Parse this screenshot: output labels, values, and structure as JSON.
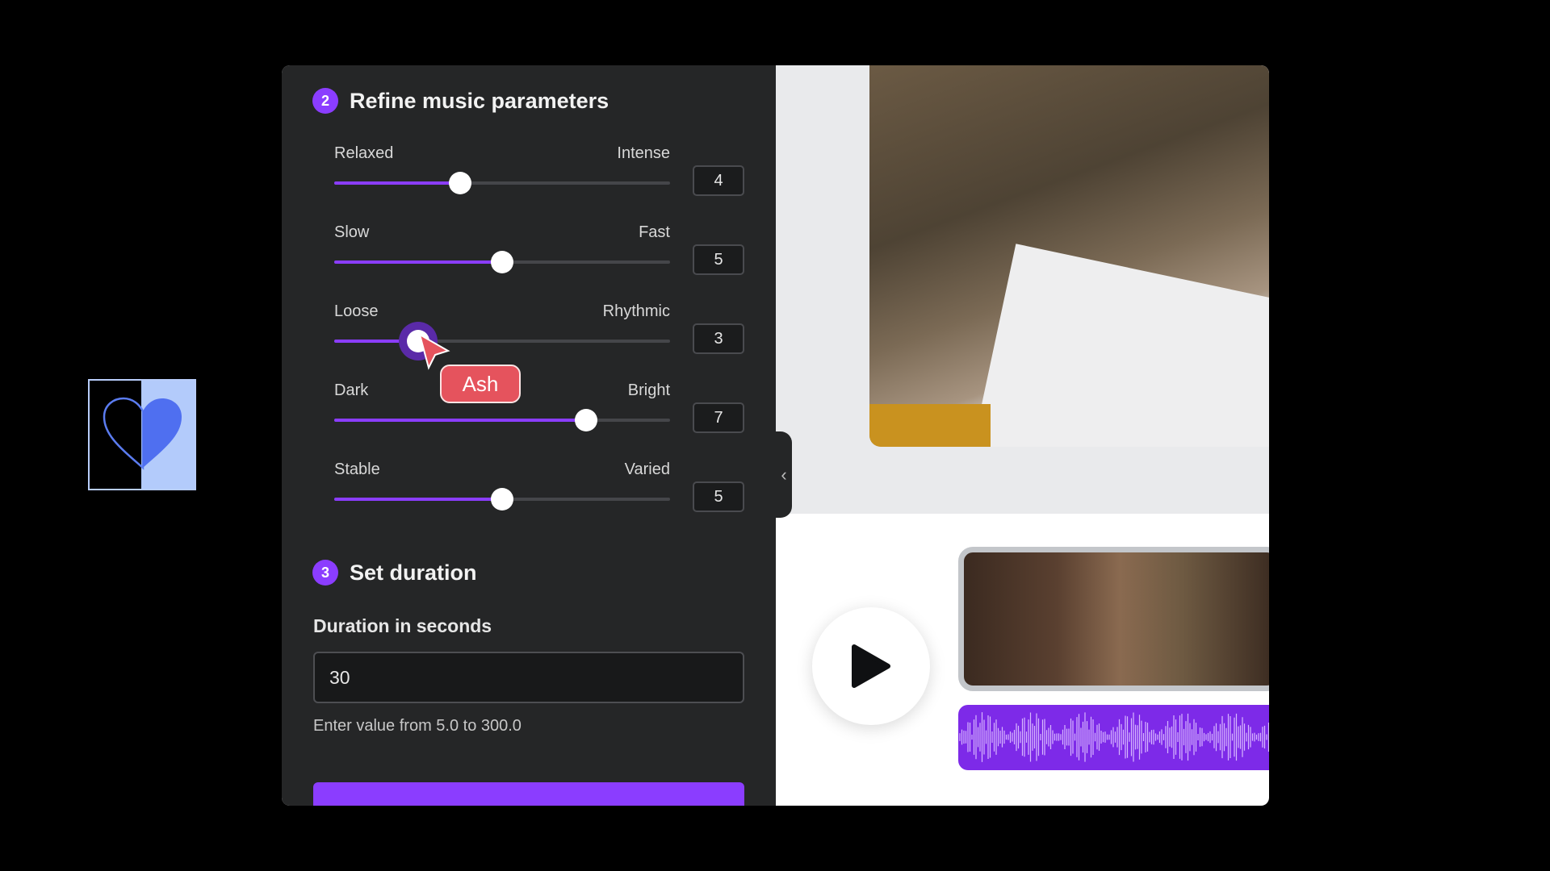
{
  "step2": {
    "number": "2",
    "title": "Refine music parameters"
  },
  "sliders": [
    {
      "left": "Relaxed",
      "right": "Intense",
      "value": "4",
      "min": 1,
      "max": 9
    },
    {
      "left": "Slow",
      "right": "Fast",
      "value": "5",
      "min": 1,
      "max": 9
    },
    {
      "left": "Loose",
      "right": "Rhythmic",
      "value": "3",
      "min": 1,
      "max": 9,
      "active": true
    },
    {
      "left": "Dark",
      "right": "Bright",
      "value": "7",
      "min": 1,
      "max": 9
    },
    {
      "left": "Stable",
      "right": "Varied",
      "value": "5",
      "min": 1,
      "max": 9
    }
  ],
  "step3": {
    "number": "3",
    "title": "Set duration"
  },
  "duration": {
    "label": "Duration in seconds",
    "value": "30",
    "help": "Enter value from 5.0 to 300.0"
  },
  "cursor": {
    "user": "Ash",
    "color": "#e5535d"
  },
  "icons": {
    "collapse": "chevron-left-icon",
    "play": "play-icon"
  },
  "colors": {
    "accent": "#8b3dff",
    "panel": "#252627",
    "waveform": "#7d2ae8"
  }
}
